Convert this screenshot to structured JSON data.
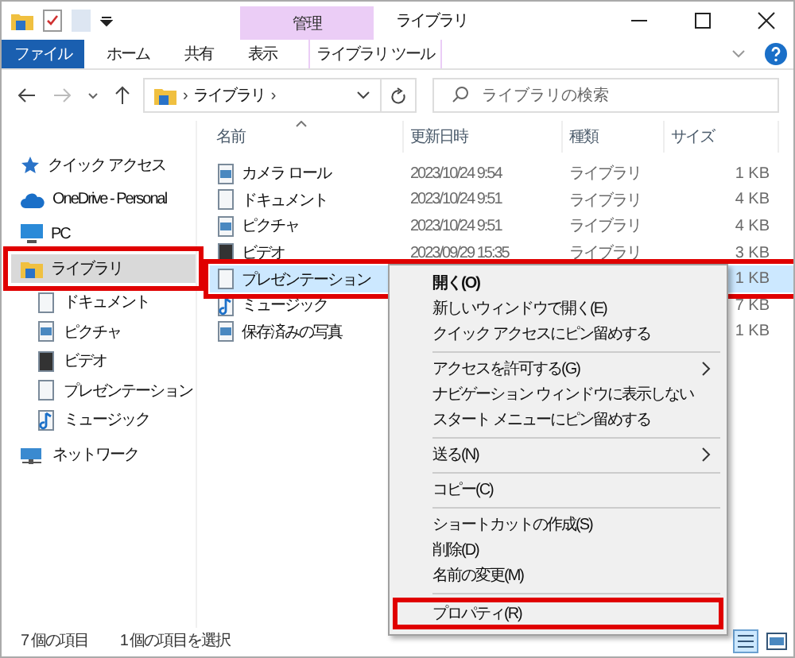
{
  "window": {
    "title": "ライブラリ",
    "context_tab": "管理"
  },
  "ribbon_tabs": [
    {
      "label": "ファイル",
      "selected": true,
      "kind": "file"
    },
    {
      "label": "ホーム",
      "selected": false,
      "kind": "tab"
    },
    {
      "label": "共有",
      "selected": false,
      "kind": "tab"
    },
    {
      "label": "表示",
      "selected": false,
      "kind": "tab"
    },
    {
      "label": "ライブラリ ツール",
      "selected": false,
      "kind": "context"
    }
  ],
  "address": {
    "crumbs": [
      "ライブラリ"
    ],
    "separator": "›"
  },
  "search": {
    "placeholder": "ライブラリの検索"
  },
  "sidebar": {
    "items": [
      {
        "label": "クイック アクセス",
        "selected": false,
        "annotated": false
      },
      {
        "label": "OneDrive - Personal",
        "selected": false,
        "annotated": false
      },
      {
        "label": "PC",
        "selected": false,
        "annotated": false
      },
      {
        "label": "ライブラリ",
        "selected": true,
        "annotated": true,
        "children": [
          {
            "label": "ドキュメント",
            "selected": false,
            "annotated": false
          },
          {
            "label": "ピクチャ",
            "selected": false,
            "annotated": false
          },
          {
            "label": "ビデオ",
            "selected": false,
            "annotated": false
          },
          {
            "label": "プレゼンテーション",
            "selected": false,
            "annotated": false
          },
          {
            "label": "ミュージック",
            "selected": false,
            "annotated": false
          }
        ]
      },
      {
        "label": "ネットワーク",
        "selected": false,
        "annotated": false
      }
    ]
  },
  "table": {
    "columns": [
      "名前",
      "更新日時",
      "種類",
      "サイズ"
    ],
    "rows": [
      {
        "name": "カメラ ロール",
        "date": "2023/10/24 9:54",
        "type": "ライブラリ",
        "size": "1 KB",
        "selected": false,
        "annotated": false
      },
      {
        "name": "ドキュメント",
        "date": "2023/10/24 9:51",
        "type": "ライブラリ",
        "size": "4 KB",
        "selected": false,
        "annotated": false
      },
      {
        "name": "ピクチャ",
        "date": "2023/10/24 9:51",
        "type": "ライブラリ",
        "size": "4 KB",
        "selected": false,
        "annotated": false
      },
      {
        "name": "ビデオ",
        "date": "2023/09/29 15:35",
        "type": "ライブラリ",
        "size": "3 KB",
        "selected": false,
        "annotated": false
      },
      {
        "name": "プレゼンテーション",
        "size": "1 KB",
        "selected": true,
        "annotated": true
      },
      {
        "name": "ミュージック",
        "size": "7 KB",
        "selected": false,
        "annotated": false
      },
      {
        "name": "保存済みの写真",
        "size": "1 KB",
        "selected": false,
        "annotated": false
      }
    ]
  },
  "context_menu": [
    {
      "kind": "item",
      "label": "開く(O)",
      "default": true,
      "annotated": false
    },
    {
      "kind": "item",
      "label": "新しいウィンドウで開く(E)",
      "default": false,
      "annotated": false
    },
    {
      "kind": "item",
      "label": "クイック アクセスにピン留めする",
      "default": false,
      "annotated": false
    },
    {
      "kind": "separator"
    },
    {
      "kind": "submenu",
      "label": "アクセスを許可する(G)",
      "default": false,
      "annotated": false
    },
    {
      "kind": "item",
      "label": "ナビゲーション ウィンドウに表示しない",
      "default": false,
      "annotated": false
    },
    {
      "kind": "item",
      "label": "スタート メニューにピン留めする",
      "default": false,
      "annotated": false
    },
    {
      "kind": "separator"
    },
    {
      "kind": "submenu",
      "label": "送る(N)",
      "default": false,
      "annotated": false
    },
    {
      "kind": "separator"
    },
    {
      "kind": "item",
      "label": "コピー(C)",
      "default": false,
      "annotated": false
    },
    {
      "kind": "separator"
    },
    {
      "kind": "item",
      "label": "ショートカットの作成(S)",
      "default": false,
      "annotated": false
    },
    {
      "kind": "item",
      "label": "削除(D)",
      "default": false,
      "annotated": false
    },
    {
      "kind": "item",
      "label": "名前の変更(M)",
      "default": false,
      "annotated": false
    },
    {
      "kind": "separator"
    },
    {
      "kind": "item",
      "label": "プロパティ(R)",
      "default": false,
      "annotated": true
    }
  ],
  "status_bar": {
    "items": [
      "7 個の項目",
      "1 個の項目を選択"
    ]
  }
}
